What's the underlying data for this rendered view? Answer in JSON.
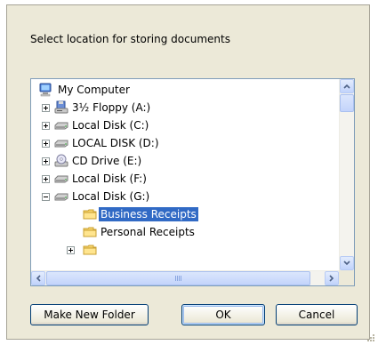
{
  "dialog": {
    "prompt": "Select location for storing documents"
  },
  "tree": {
    "items": [
      {
        "label": "My Computer",
        "icon": "my-computer-icon",
        "expander": "none",
        "selected": false
      },
      {
        "label": "3½ Floppy (A:)",
        "icon": "floppy-drive-icon",
        "expander": "plus",
        "selected": false
      },
      {
        "label": "Local Disk (C:)",
        "icon": "hard-disk-icon",
        "expander": "plus",
        "selected": false
      },
      {
        "label": "LOCAL DISK (D:)",
        "icon": "hard-disk-icon",
        "expander": "plus",
        "selected": false
      },
      {
        "label": "CD Drive (E:)",
        "icon": "cd-drive-icon",
        "expander": "plus",
        "selected": false
      },
      {
        "label": "Local Disk (F:)",
        "icon": "hard-disk-icon",
        "expander": "plus",
        "selected": false
      },
      {
        "label": "Local Disk (G:)",
        "icon": "hard-disk-icon",
        "expander": "minus",
        "selected": false
      },
      {
        "label": "Business Receipts",
        "icon": "folder-icon",
        "expander": "none",
        "selected": true
      },
      {
        "label": "Personal Receipts",
        "icon": "folder-icon",
        "expander": "none",
        "selected": false
      }
    ]
  },
  "buttons": {
    "make_new_folder": "Make New Folder",
    "ok": "OK",
    "cancel": "Cancel"
  },
  "colors": {
    "selection": "#316ac5",
    "dialog_bg": "#ece9d8",
    "tree_border": "#7f9db9"
  }
}
